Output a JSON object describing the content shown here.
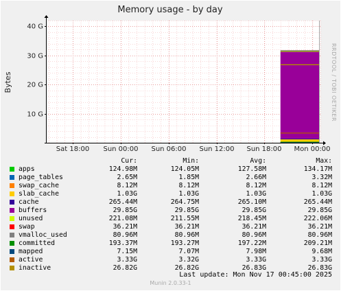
{
  "chart_data": {
    "type": "area",
    "title": "Memory usage - by day",
    "ylabel": "Bytes",
    "side_label": "RRDTOOL / TOBI OETIKER",
    "ylim": [
      0,
      42000000000
    ],
    "y_ticks": [
      {
        "value": 0,
        "label": ""
      },
      {
        "value": 10000000000,
        "label": "10 G"
      },
      {
        "value": 20000000000,
        "label": "20 G"
      },
      {
        "value": 30000000000,
        "label": "30 G"
      },
      {
        "value": 40000000000,
        "label": "40 G"
      }
    ],
    "x_ticks": [
      "Sat 18:00",
      "Sun 00:00",
      "Sun 06:00",
      "Sun 12:00",
      "Sun 18:00",
      "Mon 00:00"
    ],
    "x_start": "Sat 14:40",
    "x_end": "Mon 01:00",
    "data_start": "Sun 20:00",
    "series_type": [
      "area",
      "area",
      "area",
      "area",
      "area",
      "area",
      "area",
      "area",
      "area",
      "line",
      "line",
      "line",
      "line"
    ],
    "legend_headers": {
      "cur": "Cur:",
      "min": "Min:",
      "avg": "Avg:",
      "max": "Max:"
    },
    "series": [
      {
        "name": "apps",
        "color": "#00cc00",
        "value": 127580000,
        "cur": "124.98M",
        "min": "124.05M",
        "avg": "127.58M",
        "max": "134.17M"
      },
      {
        "name": "page_tables",
        "color": "#0066b3",
        "value": 2660000,
        "cur": "2.65M",
        "min": "1.85M",
        "avg": "2.66M",
        "max": "3.32M"
      },
      {
        "name": "swap_cache",
        "color": "#ff8000",
        "value": 8120000,
        "cur": "8.12M",
        "min": "8.12M",
        "avg": "8.12M",
        "max": "8.12M"
      },
      {
        "name": "slab_cache",
        "color": "#ffcc00",
        "value": 1030000000,
        "cur": "1.03G",
        "min": "1.03G",
        "avg": "1.03G",
        "max": "1.03G"
      },
      {
        "name": "cache",
        "color": "#330099",
        "value": 265100000,
        "cur": "265.44M",
        "min": "264.75M",
        "avg": "265.10M",
        "max": "265.44M"
      },
      {
        "name": "buffers",
        "color": "#990099",
        "value": 29850000000,
        "cur": "29.85G",
        "min": "29.85G",
        "avg": "29.85G",
        "max": "29.85G"
      },
      {
        "name": "unused",
        "color": "#ccff00",
        "value": 218450000,
        "cur": "221.08M",
        "min": "211.55M",
        "avg": "218.45M",
        "max": "222.06M"
      },
      {
        "name": "swap",
        "color": "#ff0000",
        "value": 36210000,
        "cur": "36.21M",
        "min": "36.21M",
        "avg": "36.21M",
        "max": "36.21M"
      },
      {
        "name": "vmalloc_used",
        "color": "#808080",
        "value": 80960000,
        "cur": "80.96M",
        "min": "80.96M",
        "avg": "80.96M",
        "max": "80.96M"
      },
      {
        "name": "committed",
        "color": "#008f00",
        "value": 197220000,
        "cur": "193.37M",
        "min": "193.27M",
        "avg": "197.22M",
        "max": "209.21M"
      },
      {
        "name": "mapped",
        "color": "#00487d",
        "value": 7980000,
        "cur": "7.15M",
        "min": "7.07M",
        "avg": "7.98M",
        "max": "9.68M"
      },
      {
        "name": "active",
        "color": "#b35a00",
        "value": 3330000000,
        "cur": "3.33G",
        "min": "3.32G",
        "avg": "3.33G",
        "max": "3.33G"
      },
      {
        "name": "inactive",
        "color": "#b38f00",
        "value": 26830000000,
        "cur": "26.82G",
        "min": "26.82G",
        "avg": "26.83G",
        "max": "26.83G"
      }
    ]
  },
  "last_update": "Last update:  Mon Nov 17 00:45:00 2025",
  "footer": "Munin 2.0.33-1"
}
